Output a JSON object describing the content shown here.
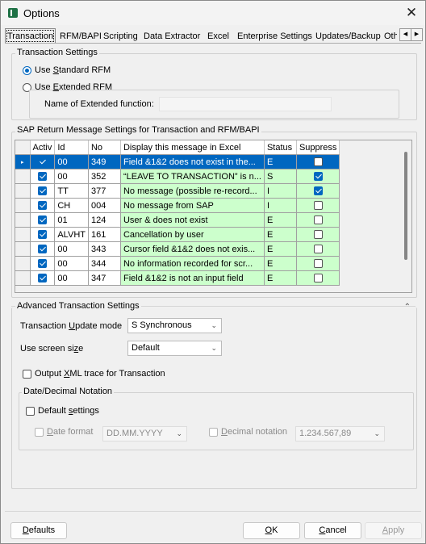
{
  "window": {
    "title": "Options",
    "close_icon": "close-icon",
    "app_icon": "excel-addin-icon"
  },
  "tabs": [
    {
      "label": "Transaction",
      "active": true
    },
    {
      "label": "RFM/BAPI"
    },
    {
      "label": "Scripting"
    },
    {
      "label": "Data Extractor"
    },
    {
      "label": "Excel"
    },
    {
      "label": "Enterprise Settings"
    },
    {
      "label": "Updates/Backup"
    },
    {
      "label": "Oth"
    }
  ],
  "transaction_settings": {
    "title": "Transaction Settings",
    "standard_rfm_pre": "Use ",
    "standard_rfm_u": "S",
    "standard_rfm_post": "tandard RFM",
    "extended_rfm_pre": "Use ",
    "extended_rfm_u": "E",
    "extended_rfm_post": "xtended RFM",
    "extended_function_label": "Name of Extended function:",
    "extended_function_value": "",
    "selected": "standard"
  },
  "sap_return": {
    "title": "SAP Return Message Settings for Transaction and RFM/BAPI",
    "columns": [
      "Activ",
      "Id",
      "No",
      "Display this message in Excel",
      "Status",
      "Suppress"
    ],
    "rows": [
      {
        "active": true,
        "id": "00",
        "no": "349",
        "message": "Field &1&2 does not exist in the...",
        "status": "E",
        "suppress": false,
        "selected": true
      },
      {
        "active": true,
        "id": "00",
        "no": "352",
        "message": "“LEAVE TO TRANSACTION” is n...",
        "status": "S",
        "suppress": true
      },
      {
        "active": true,
        "id": "TT",
        "no": "377",
        "message": "No message (possible re-record...",
        "status": "I",
        "suppress": true
      },
      {
        "active": true,
        "id": "CH",
        "no": "004",
        "message": "No message from SAP",
        "status": "I",
        "suppress": false
      },
      {
        "active": true,
        "id": "01",
        "no": "124",
        "message": "User & does not exist",
        "status": "E",
        "suppress": false
      },
      {
        "active": true,
        "id": "ALVHT",
        "no": "161",
        "message": "Cancellation by user",
        "status": "E",
        "suppress": false
      },
      {
        "active": true,
        "id": "00",
        "no": "343",
        "message": "Cursor field &1&2 does not exis...",
        "status": "E",
        "suppress": false
      },
      {
        "active": true,
        "id": "00",
        "no": "344",
        "message": "No information recorded for scr...",
        "status": "E",
        "suppress": false
      },
      {
        "active": true,
        "id": "00",
        "no": "347",
        "message": "Field &1&2 is not an input field",
        "status": "E",
        "suppress": false
      }
    ]
  },
  "advanced": {
    "title": "Advanced Transaction Settings",
    "update_mode_pre": "Transaction ",
    "update_mode_u": "U",
    "update_mode_post": "pdate mode",
    "update_mode_value": "S Synchronous",
    "screen_size_pre": "Use screen si",
    "screen_size_u": "z",
    "screen_size_post": "e",
    "screen_size_value": "Default",
    "xml_trace_pre": "Output ",
    "xml_trace_u": "X",
    "xml_trace_post": "ML trace for Transaction",
    "xml_trace_checked": false,
    "date_group_title": "Date/Decimal Notation",
    "default_settings_pre": "Default ",
    "default_settings_u": "s",
    "default_settings_post": "ettings",
    "date_format_u": "D",
    "date_format_post": "ate format",
    "date_format_value": "DD.MM.YYYY",
    "decimal_u": "D",
    "decimal_post": "ecimal notation",
    "decimal_value": "1.234.567,89"
  },
  "buttons": {
    "defaults_u": "D",
    "defaults_post": "efaults",
    "ok_u": "O",
    "ok_post": "K",
    "cancel_u": "C",
    "cancel_post": "ancel",
    "apply_u": "A",
    "apply_post": "pply"
  }
}
